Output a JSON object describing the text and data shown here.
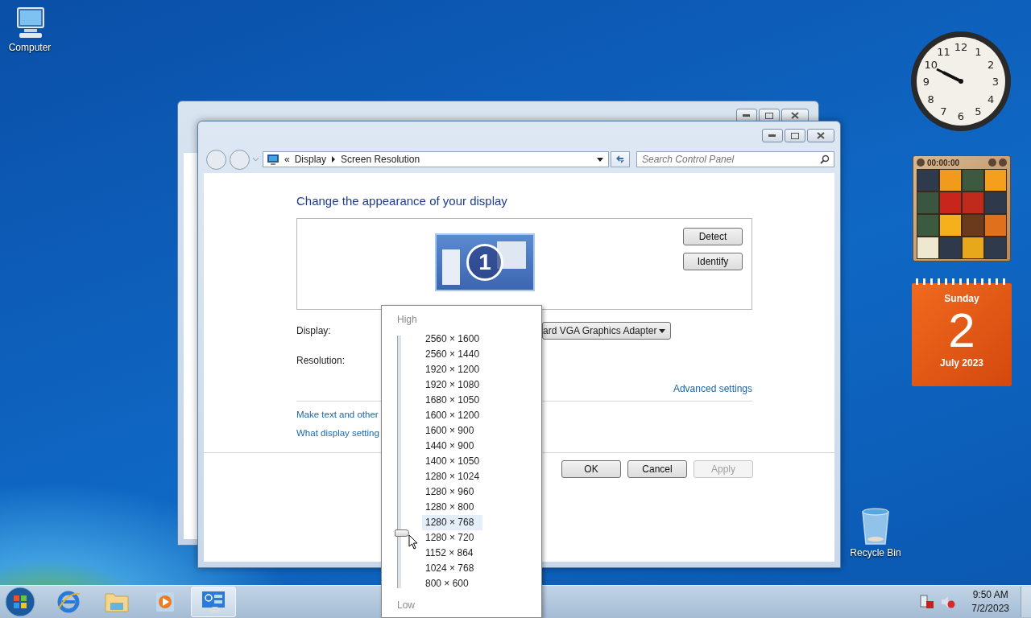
{
  "desktop_icons": [
    {
      "label": "Computer",
      "kind": "computer"
    },
    {
      "label": "Recycle Bin",
      "kind": "recycle-bin"
    }
  ],
  "window": {
    "address": {
      "chevron": "«",
      "path": [
        "Display",
        "Screen Resolution"
      ]
    },
    "search": {
      "placeholder": "Search Control Panel"
    },
    "heading": "Change the appearance of your display",
    "monitor_number": "1",
    "side_buttons": [
      "Detect",
      "Identify"
    ],
    "fields": [
      {
        "label": "Display:",
        "value": "ard VGA Graphics Adapter"
      },
      {
        "label": "Resolution:"
      }
    ],
    "advanced_link": "Advanced settings",
    "links": [
      "Make text and other",
      "What display setting"
    ],
    "buttons": [
      {
        "label": "OK",
        "disabled": false
      },
      {
        "label": "Cancel",
        "disabled": false
      },
      {
        "label": "Apply",
        "disabled": true
      }
    ]
  },
  "resolution_popup": {
    "high": "High",
    "low": "Low",
    "level": 0.25,
    "options": [
      {
        "label": "2560 × 1600",
        "selected": false
      },
      {
        "label": "2560 × 1440",
        "selected": false
      },
      {
        "label": "1920 × 1200",
        "selected": false
      },
      {
        "label": "1920 × 1080",
        "selected": false
      },
      {
        "label": "1680 × 1050",
        "selected": false
      },
      {
        "label": "1600 × 1200",
        "selected": false
      },
      {
        "label": "1600 × 900",
        "selected": false
      },
      {
        "label": "1440 × 900",
        "selected": false
      },
      {
        "label": "1400 × 1050",
        "selected": false
      },
      {
        "label": "1280 × 1024",
        "selected": false
      },
      {
        "label": "1280 × 960",
        "selected": false
      },
      {
        "label": "1280 × 800",
        "selected": false
      },
      {
        "label": "1280 × 768",
        "selected": true
      },
      {
        "label": "1280 × 720",
        "selected": false
      },
      {
        "label": "1152 × 864",
        "selected": false
      },
      {
        "label": "1024 × 768",
        "selected": false
      },
      {
        "label": "800 × 600",
        "selected": false
      }
    ]
  },
  "gadgets": {
    "clock": {
      "numerals": [
        "12",
        "11",
        "1",
        "10",
        "2",
        "9",
        "3",
        "8",
        "4",
        "7",
        "5",
        "6"
      ]
    },
    "puzzle": {
      "timer": "00:00:00"
    },
    "calendar": {
      "weekday": "Sunday",
      "day": "2",
      "month_year": "July 2023"
    }
  },
  "taskbar": {
    "items": [
      {
        "kind": "browser",
        "selected": false
      },
      {
        "kind": "folder",
        "selected": false
      },
      {
        "kind": "media",
        "selected": false
      },
      {
        "kind": "control-panel",
        "selected": true
      }
    ],
    "time": "9:50 AM",
    "date": "7/2/2023"
  }
}
